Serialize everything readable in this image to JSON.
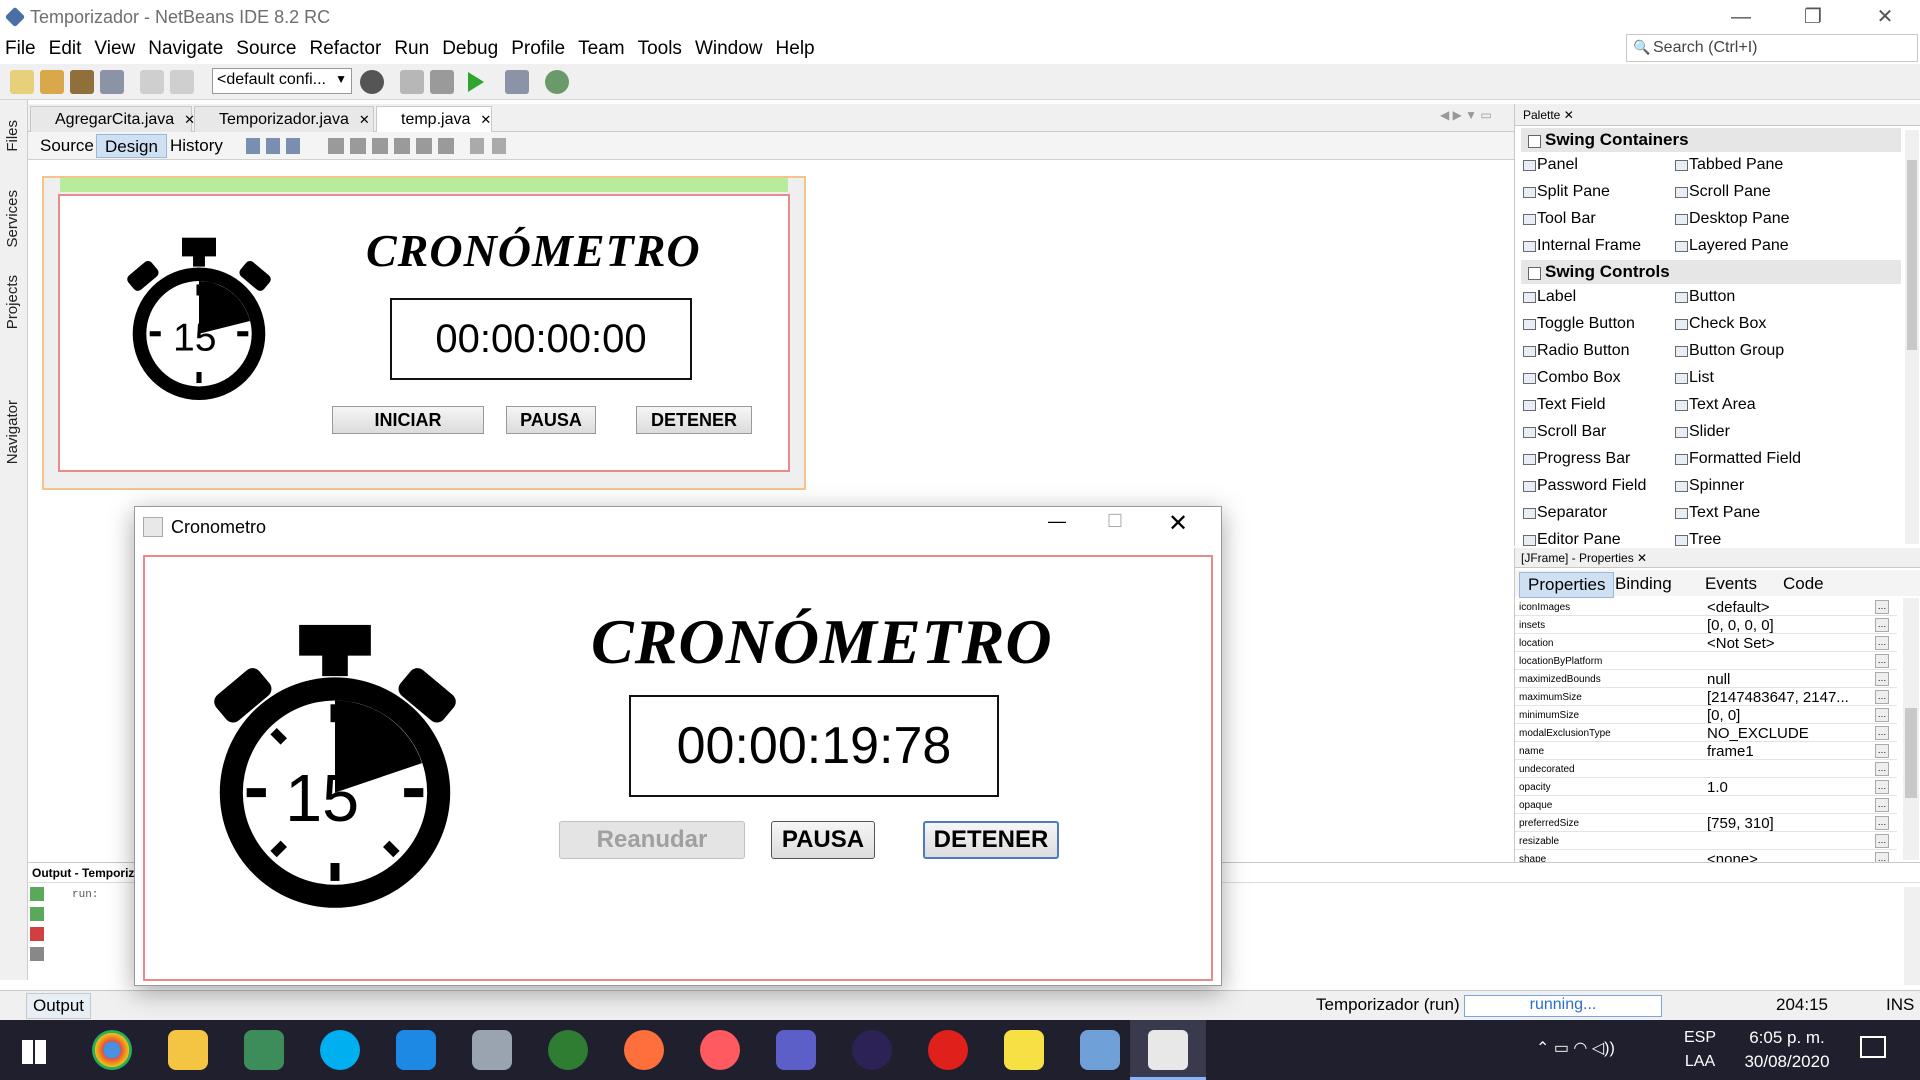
{
  "window": {
    "title": "Temporizador - NetBeans IDE 8.2 RC"
  },
  "menu": [
    "File",
    "Edit",
    "View",
    "Navigate",
    "Source",
    "Refactor",
    "Run",
    "Debug",
    "Profile",
    "Team",
    "Tools",
    "Window",
    "Help"
  ],
  "search": {
    "placeholder": "Search (Ctrl+I)"
  },
  "toolbar": {
    "config": "<default confi..."
  },
  "left_strip": [
    "Files",
    "Services",
    "Projects",
    "Navigator"
  ],
  "editor": {
    "tabs": [
      "AgregarCita.java",
      "Temporizador.java",
      "temp.java"
    ],
    "modes": [
      "Source",
      "Design",
      "History"
    ],
    "active_mode": "Design"
  },
  "design_preview": {
    "title": "CRONÓMETRO",
    "time": "00:00:00:00",
    "buttons": [
      "INICIAR",
      "PAUSA",
      "DETENER"
    ],
    "dial_number": "15"
  },
  "palette": {
    "header": "Palette",
    "categories": [
      {
        "name": "Swing Containers",
        "items": [
          [
            "Panel",
            "Tabbed Pane"
          ],
          [
            "Split Pane",
            "Scroll Pane"
          ],
          [
            "Tool Bar",
            "Desktop Pane"
          ],
          [
            "Internal Frame",
            "Layered Pane"
          ]
        ]
      },
      {
        "name": "Swing Controls",
        "items": [
          [
            "Label",
            "Button"
          ],
          [
            "Toggle Button",
            "Check Box"
          ],
          [
            "Radio Button",
            "Button Group"
          ],
          [
            "Combo Box",
            "List"
          ],
          [
            "Text Field",
            "Text Area"
          ],
          [
            "Scroll Bar",
            "Slider"
          ],
          [
            "Progress Bar",
            "Formatted Field"
          ],
          [
            "Password Field",
            "Spinner"
          ],
          [
            "Separator",
            "Text Pane"
          ],
          [
            "Editor Pane",
            "Tree"
          ]
        ]
      }
    ]
  },
  "properties": {
    "header": "[JFrame] - Properties",
    "tabs": [
      "Properties",
      "Binding",
      "Events",
      "Code"
    ],
    "rows": [
      {
        "k": "iconImages",
        "v": "<default>"
      },
      {
        "k": "insets",
        "v": "[0, 0, 0, 0]"
      },
      {
        "k": "location",
        "v": "<Not Set>"
      },
      {
        "k": "locationByPlatform",
        "v": ""
      },
      {
        "k": "maximizedBounds",
        "v": "null"
      },
      {
        "k": "maximumSize",
        "v": "[2147483647, 2147..."
      },
      {
        "k": "minimumSize",
        "v": "[0, 0]"
      },
      {
        "k": "modalExclusionType",
        "v": "NO_EXCLUDE"
      },
      {
        "k": "name",
        "v": "frame1"
      },
      {
        "k": "undecorated",
        "v": ""
      },
      {
        "k": "opacity",
        "v": "1.0"
      },
      {
        "k": "opaque",
        "v": ""
      },
      {
        "k": "preferredSize",
        "v": "[759, 310]"
      },
      {
        "k": "resizable",
        "v": ""
      },
      {
        "k": "shape",
        "v": "<none>"
      }
    ]
  },
  "output": {
    "tab": "Output - Temporiz",
    "label": "Output",
    "text": "run:"
  },
  "statusbar": {
    "project": "Temporizador (run)",
    "progress": "running...",
    "position": "204:15",
    "mode": "INS"
  },
  "taskbar": {
    "lang1": "ESP",
    "lang2": "LAA",
    "time": "6:05 p. m.",
    "date": "30/08/2020"
  },
  "app": {
    "title": "Cronometro",
    "heading": "CRONÓMETRO",
    "time": "00:00:19:78",
    "dial_number": "15",
    "btn_resume": "Reanudar",
    "btn_pause": "PAUSA",
    "btn_stop": "DETENER"
  }
}
